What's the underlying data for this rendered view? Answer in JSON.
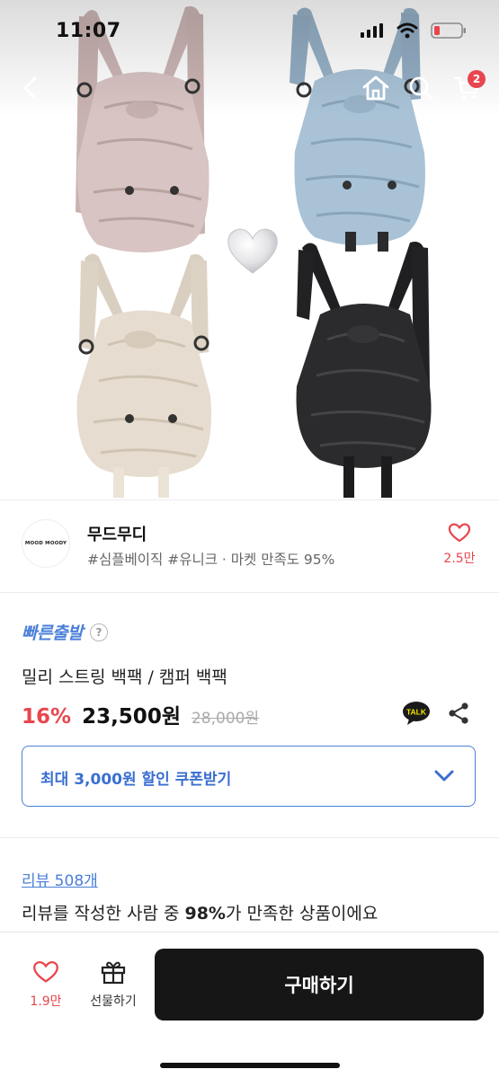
{
  "status_bar": {
    "time": "11:07"
  },
  "nav": {
    "cart_badge": "2"
  },
  "seller": {
    "logo_text": "MOOD MOODY",
    "name": "무드무디",
    "tags": "#심플베이직 #유니크 · 마켓 만족도 95%",
    "favorite_count": "2.5만"
  },
  "product": {
    "shipping_badge": "빠른출발",
    "help_icon_glyph": "?",
    "title": "밀리 스트링 백팩 / 캠퍼 백팩",
    "discount": "16%",
    "price": "23,500원",
    "original_price": "28,000원",
    "talk_label": "TALK"
  },
  "coupon": {
    "label": "최대 3,000원 할인 쿠폰받기"
  },
  "reviews": {
    "link": "리뷰 508개",
    "summary_prefix": "리뷰를 작성한 사람 중 ",
    "summary_bold": "98%",
    "summary_suffix": "가 만족한 상품이에요"
  },
  "bottom_bar": {
    "like_count": "1.9만",
    "gift_label": "선물하기",
    "buy_label": "구매하기"
  },
  "colors": {
    "accent_red": "#e8464e",
    "accent_blue": "#4a7fd8",
    "dark": "#161616",
    "bag_pink": "#d8c4c2",
    "bag_blue": "#a9c2d6",
    "bag_beige": "#e6ddd0",
    "bag_black": "#2b2b2d"
  },
  "icons": [
    "signal-icon",
    "wifi-icon",
    "battery-icon",
    "back-icon",
    "home-icon",
    "search-icon",
    "cart-icon",
    "heart-icon",
    "help-icon",
    "kakaotalk-icon",
    "share-icon",
    "chevron-down-icon",
    "gift-icon"
  ]
}
